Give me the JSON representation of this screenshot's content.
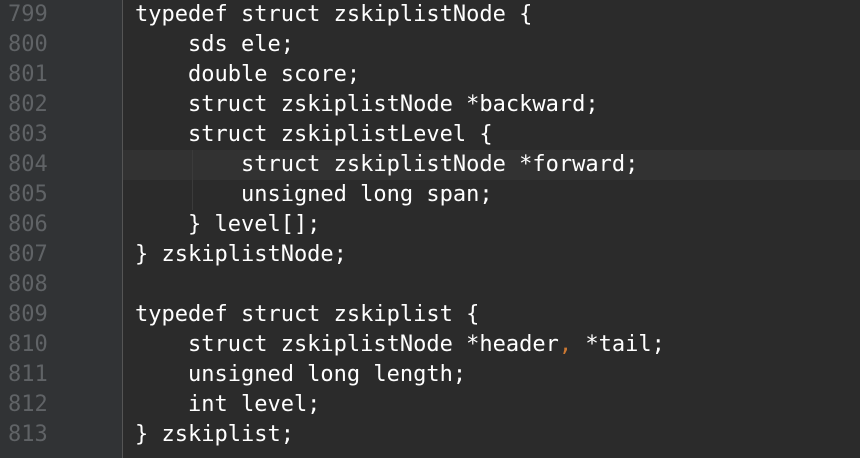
{
  "editor": {
    "lines": [
      {
        "number": "799",
        "code": "typedef struct zskiplistNode {"
      },
      {
        "number": "800",
        "code": "    sds ele;"
      },
      {
        "number": "801",
        "code": "    double score;"
      },
      {
        "number": "802",
        "code": "    struct zskiplistNode *backward;"
      },
      {
        "number": "803",
        "code": "    struct zskiplistLevel {"
      },
      {
        "number": "804",
        "code": "        struct zskiplistNode *forward;"
      },
      {
        "number": "805",
        "code": "        unsigned long span;"
      },
      {
        "number": "806",
        "code": "    } level[];"
      },
      {
        "number": "807",
        "code": "} zskiplistNode;"
      },
      {
        "number": "808",
        "code": ""
      },
      {
        "number": "809",
        "code": "typedef struct zskiplist {"
      },
      {
        "number": "810",
        "code_before": "    struct zskiplistNode *header",
        "comma": ",",
        "code_after": " *tail;"
      },
      {
        "number": "811",
        "code": "    unsigned long length;"
      },
      {
        "number": "812",
        "code": "    int level;"
      },
      {
        "number": "813",
        "code": "} zskiplist;"
      }
    ],
    "colors": {
      "background": "#2b2b2b",
      "gutter": "#313335",
      "line_number": "#606366",
      "text": "#ffffff",
      "comma": "#cc7832",
      "current_line": "#323232"
    }
  }
}
